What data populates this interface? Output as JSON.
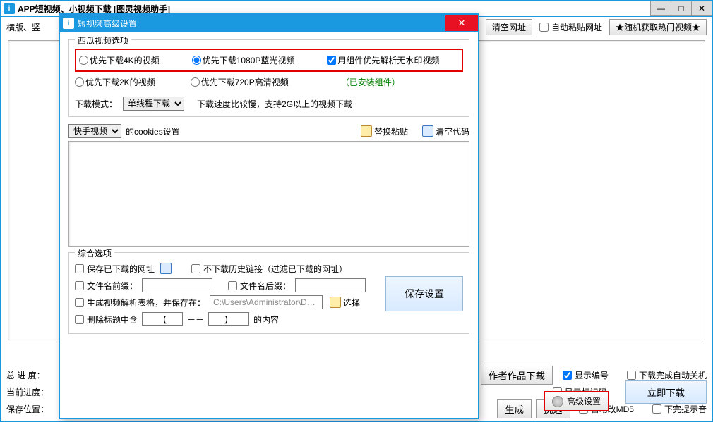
{
  "mainWindow": {
    "title": "APP短视频、小视频下载 [图灵视频助手]",
    "toolbarLeft": "横版、竖",
    "clearUrls": "清空网址",
    "autoPaste": "自动粘贴网址",
    "randomHot": "★随机获取热门视频★"
  },
  "bottom": {
    "totalProgress": "总 进 度：",
    "currentProgress": "当前进度：",
    "savePath": "保存位置：",
    "authorWorks": "作者作品下载",
    "generate": "生成",
    "filter": "挑选",
    "showIndex": "显示编号",
    "showId": "显示标识码",
    "autoMd5": "自动改MD5",
    "autoShutdown": "下载完成自动关机",
    "downloadNow": "立即下载",
    "soundOnDone": "下完提示音",
    "advanced": "高级设置"
  },
  "dialog": {
    "title": "短视频高级设置",
    "group1": "西瓜视频选项",
    "radio4k": "优先下载4K的视频",
    "radio1080": "优先下载1080P蓝光视频",
    "checkPlugin": "用组件优先解析无水印视频",
    "radio2k": "优先下载2K的视频",
    "radio720": "优先下载720P高清视频",
    "installed": "（已安装组件）",
    "dlMode": "下载模式：",
    "dlModeSingle": "单线程下载",
    "dlModeNote": "下载速度比较慢，支持2G以上的视频下载",
    "cookiesSource": "快手视频",
    "cookiesLabel": "的cookies设置",
    "replacePaste": "替换粘贴",
    "clearCode": "清空代码",
    "group2": "综合选项",
    "saveDownloaded": "保存已下载的网址",
    "skipHistory": "不下载历史链接（过滤已下载的网址）",
    "prefix": "文件名前缀：",
    "suffix": "文件名后缀：",
    "genTable": "生成视频解析表格，并保存在：",
    "tablePath": "C:\\Users\\Administrator\\D…",
    "choose": "选择",
    "delTitle": "删除标题中含",
    "bracketL": "【",
    "dashdash": "－－",
    "bracketR": "】",
    "delTitleAfter": "的内容",
    "saveSettings": "保存设置"
  }
}
